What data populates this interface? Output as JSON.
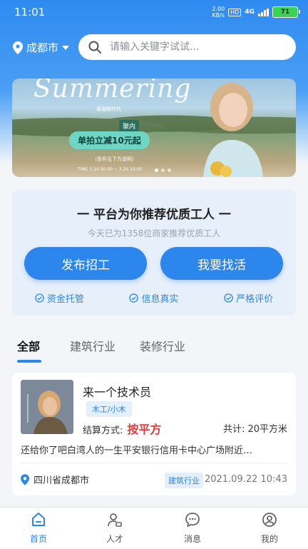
{
  "status": {
    "time": "11:01",
    "speed_value": "2.00",
    "speed_unit": "KB/s",
    "hd": "HD",
    "signal": "4G",
    "battery": "71"
  },
  "header": {
    "city": "成都市",
    "search_placeholder": "请输入关键字试试..."
  },
  "banner": {
    "script_text": "Summering",
    "subtitle": "香港新时代",
    "tag": "聚内",
    "promo": "单拍立减10元起",
    "small_text": "（条件见下方说明）",
    "date_text": "TIME 3.24 00:00 ~ 3.26 24:00"
  },
  "recommend": {
    "title": "一  平台为你推荐优质工人  一",
    "subtitle": "今天已为1358位商家推荐优质工人",
    "post_button": "发布招工",
    "find_button": "我要找活",
    "features": [
      "资金托管",
      "信息真实",
      "严格评价"
    ]
  },
  "tabs": [
    "全部",
    "建筑行业",
    "装修行业"
  ],
  "card": {
    "title": "来一个技术员",
    "tag": "木工/小木",
    "settle_label": "结算方式:",
    "settle_value": "按平方",
    "total": "共计: 20平方米",
    "description": "还给你了吧白湾人的一生平安银行信用卡中心广场附近…",
    "location": "四川省成都市",
    "industry": "建筑行业",
    "date": "2021.09.22 10:43"
  },
  "tabbar": [
    "首页",
    "人才",
    "消息",
    "我的"
  ],
  "colors": {
    "primary": "#2c86ec",
    "price": "#e23c3c"
  }
}
